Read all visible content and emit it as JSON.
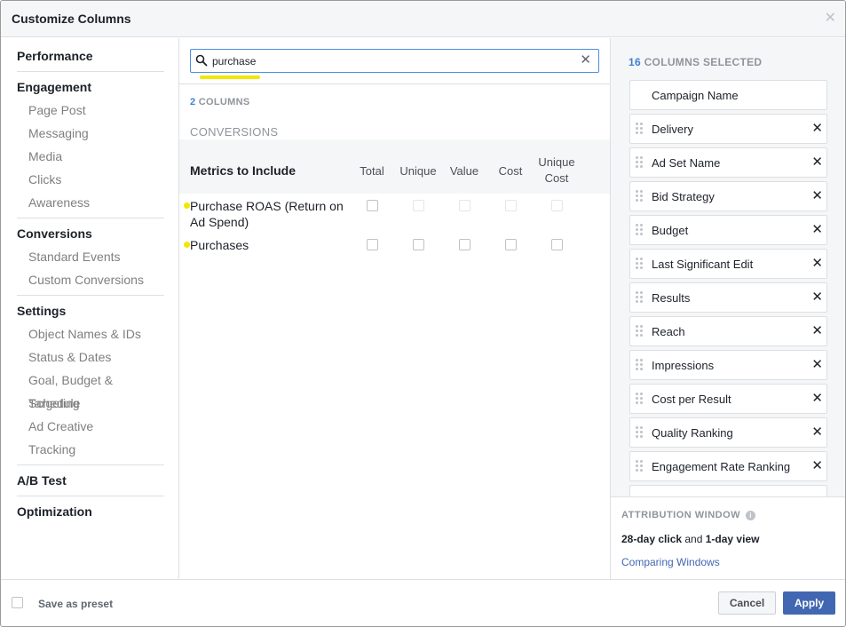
{
  "dialog": {
    "title": "Customize Columns",
    "close_icon": "close-icon"
  },
  "nav": {
    "sections": [
      {
        "heading": "Performance",
        "items": []
      },
      {
        "heading": "Engagement",
        "items": [
          "Page Post",
          "Messaging",
          "Media",
          "Clicks",
          "Awareness"
        ]
      },
      {
        "heading": "Conversions",
        "items": [
          "Standard Events",
          "Custom Conversions"
        ]
      },
      {
        "heading": "Settings",
        "items": [
          "Object Names & IDs",
          "Status & Dates",
          "Goal, Budget & Schedule",
          "Targeting",
          "Ad Creative",
          "Tracking"
        ]
      },
      {
        "heading": "A/B Test",
        "items": []
      },
      {
        "heading": "Optimization",
        "items": []
      }
    ]
  },
  "search": {
    "value": "purchase",
    "placeholder": ""
  },
  "results": {
    "count_num": "2",
    "count_label": "COLUMNS",
    "section": "CONVERSIONS",
    "metrics_title": "Metrics to Include",
    "columns": [
      "Total",
      "Unique",
      "Value",
      "Cost",
      "Unique Cost"
    ],
    "rows": [
      {
        "name": "Purchase ROAS (Return on Ad Spend)",
        "checked": [
          false,
          false,
          false,
          false,
          false
        ],
        "enabled": [
          true,
          false,
          false,
          false,
          false
        ]
      },
      {
        "name": "Purchases",
        "checked": [
          false,
          false,
          false,
          false,
          false
        ],
        "enabled": [
          true,
          true,
          true,
          true,
          true
        ]
      }
    ]
  },
  "selected": {
    "count_num": "16",
    "count_label": "COLUMNS SELECTED",
    "columns": [
      "Campaign Name",
      "Delivery",
      "Ad Set Name",
      "Bid Strategy",
      "Budget",
      "Last Significant Edit",
      "Results",
      "Reach",
      "Impressions",
      "Cost per Result",
      "Quality Ranking",
      "Engagement Rate Ranking"
    ]
  },
  "attribution": {
    "title": "ATTRIBUTION WINDOW",
    "click_window": "28-day click",
    "joiner": " and ",
    "view_window": "1-day view",
    "link": "Comparing Windows"
  },
  "footer": {
    "preset_label": "Save as preset",
    "cancel_label": "Cancel",
    "apply_label": "Apply"
  },
  "colors": {
    "accent": "#4267b2",
    "count_blue": "#4080d0",
    "highlight": "#f3e600"
  }
}
